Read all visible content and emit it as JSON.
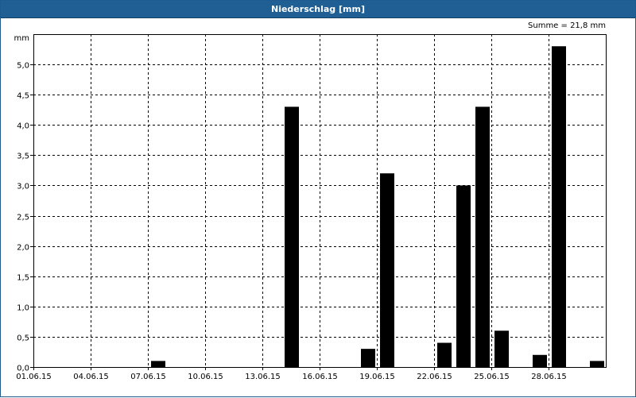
{
  "window": {
    "title": "Niederschlag [mm]"
  },
  "chart_data": {
    "type": "bar",
    "title": "Niederschlag [mm]",
    "annotation": "Summe = 21,8 mm",
    "ylabel": "mm",
    "ylim": [
      0,
      5.5
    ],
    "yticks": [
      "0,0",
      "0,5",
      "1,0",
      "1,5",
      "2,0",
      "2,5",
      "3,0",
      "3,5",
      "4,0",
      "4,5",
      "5,0"
    ],
    "xticks": [
      "01.06.15",
      "04.06.15",
      "07.06.15",
      "10.06.15",
      "13.06.15",
      "16.06.15",
      "19.06.15",
      "22.06.15",
      "25.06.15",
      "28.06.15"
    ],
    "grid": true,
    "bar_color": "#000000",
    "categories": [
      "01.06.15",
      "02.06.15",
      "03.06.15",
      "04.06.15",
      "05.06.15",
      "06.06.15",
      "07.06.15",
      "08.06.15",
      "09.06.15",
      "10.06.15",
      "11.06.15",
      "12.06.15",
      "13.06.15",
      "14.06.15",
      "15.06.15",
      "16.06.15",
      "17.06.15",
      "18.06.15",
      "19.06.15",
      "20.06.15",
      "21.06.15",
      "22.06.15",
      "23.06.15",
      "24.06.15",
      "25.06.15",
      "26.06.15",
      "27.06.15",
      "28.06.15",
      "29.06.15",
      "30.06.15"
    ],
    "values": [
      0,
      0,
      0,
      0,
      0,
      0,
      0.1,
      0,
      0,
      0,
      0,
      0,
      0,
      4.3,
      0,
      0,
      0,
      0.3,
      3.2,
      0,
      0,
      0.4,
      3.0,
      4.3,
      0.6,
      0,
      0.2,
      5.3,
      0,
      0.1
    ]
  }
}
